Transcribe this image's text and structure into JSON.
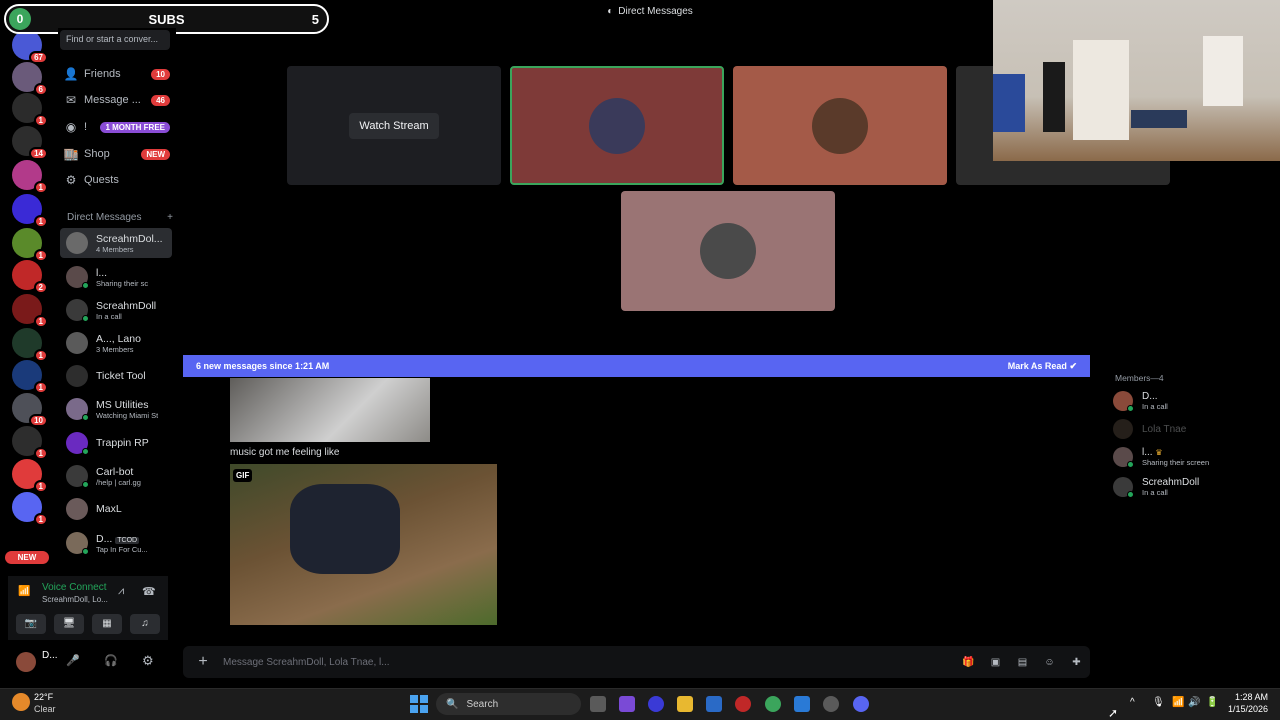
{
  "overlay": {
    "subs_label": "SUBS",
    "left_count": "0",
    "right_count": "5"
  },
  "header": {
    "title": "Direct Messages"
  },
  "rail": {
    "badges": [
      "67",
      "6",
      "1",
      "14",
      "1",
      "1",
      "1",
      "2",
      "1",
      "1",
      "1",
      "10",
      "1",
      "1",
      "1"
    ],
    "new_label": "NEW"
  },
  "sidebar": {
    "search_placeholder": "Find or start a conver...",
    "nav": [
      {
        "label": "Friends",
        "badge": "10",
        "icon": "friends-icon"
      },
      {
        "label": "Message ...",
        "badge": "46",
        "icon": "message-requests-icon"
      },
      {
        "label": "!",
        "badge": "1 MONTH FREE",
        "icon": "nitro-icon"
      },
      {
        "label": "Shop",
        "badge": "NEW",
        "icon": "shop-icon"
      },
      {
        "label": "Quests",
        "badge": "",
        "icon": "quests-icon"
      }
    ],
    "dm_header": "Direct Messages",
    "dm_add": "+",
    "dms": [
      {
        "name": "ScreahmDol...",
        "sub": "4 Members"
      },
      {
        "name": "l...",
        "sub": "Sharing their sc"
      },
      {
        "name": "ScreahmDoll",
        "sub": "In a call"
      },
      {
        "name": "A..., Lano",
        "sub": "3 Members"
      },
      {
        "name": "Ticket Tool",
        "sub": ""
      },
      {
        "name": "MS Utilities",
        "sub": "Watching Miami St"
      },
      {
        "name": "Trappin RP",
        "sub": ""
      },
      {
        "name": "Carl-bot",
        "sub": "/help | carl.gg"
      },
      {
        "name": "MaxL",
        "sub": ""
      },
      {
        "name": "D...",
        "sub": "Tap In For Cu..."
      }
    ],
    "dm_tag": "TCOD"
  },
  "voice": {
    "status": "Voice Connect",
    "channel": "ScreahmDoll, Lo..."
  },
  "user": {
    "name": "D..."
  },
  "tiles": {
    "watch_label": "Watch Stream"
  },
  "banner": {
    "text": "6 new messages since 1:21 AM",
    "action": "Mark As Read"
  },
  "chat": {
    "message": "music got me feeling like",
    "gif_tag": "GIF"
  },
  "composer": {
    "placeholder": "Message ScreahmDoll, Lola Tnae, l..."
  },
  "members": {
    "header": "Members—4",
    "list": [
      {
        "name": "D...",
        "sub": "In a call"
      },
      {
        "name": "Lola Tnae",
        "sub": ""
      },
      {
        "name": "l...",
        "sub": "Sharing their screen"
      },
      {
        "name": "ScreahmDoll",
        "sub": "In a call"
      }
    ]
  },
  "taskbar": {
    "weather_temp": "22°F",
    "weather_desc": "Clear",
    "search_label": "Search",
    "time": "1:28 AM",
    "date": "1/15/2026"
  },
  "colors": {
    "accent": "#5865f2",
    "online": "#23a55a",
    "danger": "#e03b3b"
  }
}
